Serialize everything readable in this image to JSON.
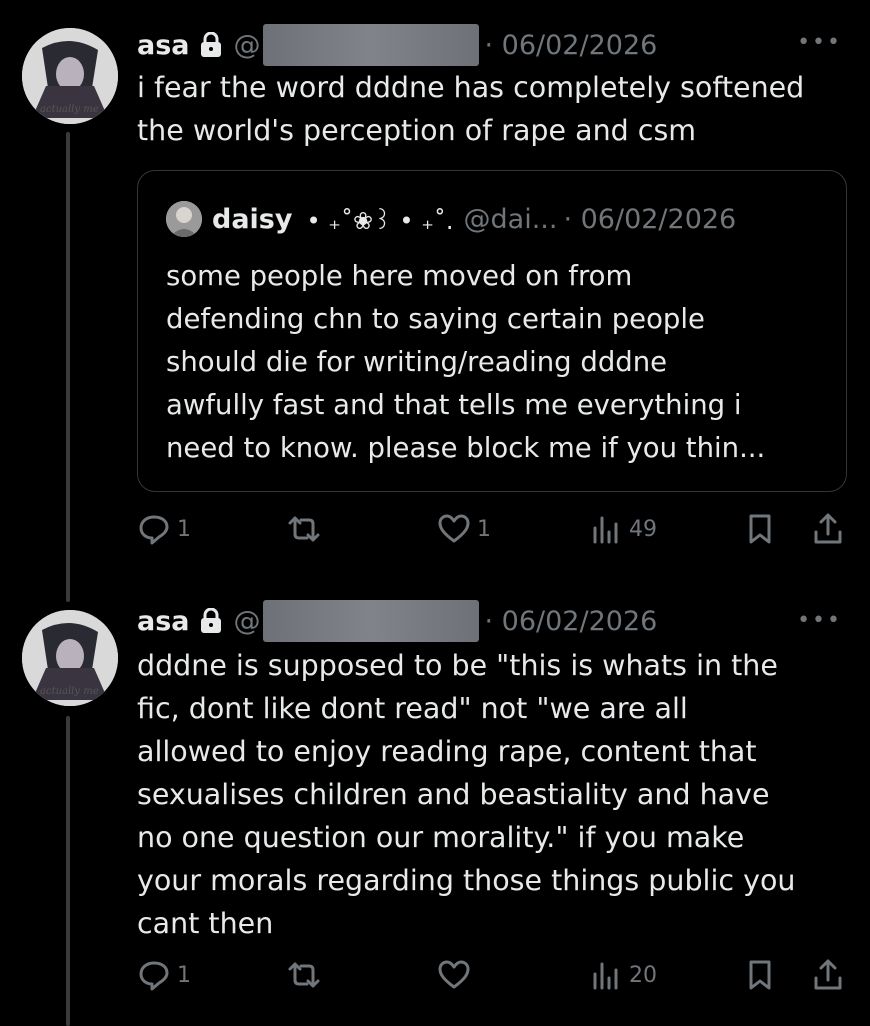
{
  "posts": [
    {
      "author": "asa",
      "handle_prefix": "@",
      "date": "· 06/02/2026",
      "more": "•••",
      "text": "i fear the word dddne has completely softened\nthe world's perception of rape and csm",
      "quote": {
        "author": "daisy",
        "decoration": "• ₊˚❀꒱ • ₊˚.",
        "handle": "@dai...",
        "date": "· 06/02/2026",
        "text": "some people here moved on from\ndefending chn to saying certain people\nshould die for writing/reading dddne\nawfully fast and that tells me everything i\nneed to know. please block me if you thin..."
      },
      "replies": "1",
      "reposts": "",
      "likes": "1",
      "views": "49"
    },
    {
      "author": "asa",
      "handle_prefix": "@",
      "date": "· 06/02/2026",
      "more": "•••",
      "text": "dddne is supposed to be \"this is whats in the\nfic, dont like dont read\" not \"we are all\nallowed to enjoy reading rape, content that\nsexualises children and beastiality and have\nno one question our morality.\" if you make\nyour morals regarding those things public you\ncant then",
      "replies": "1",
      "reposts": "",
      "likes": "",
      "views": "20"
    }
  ],
  "avatar_caption": "actually me",
  "colors": {
    "background": "#000000",
    "text": "#e7e9ea",
    "muted": "#71767b",
    "border": "#333639"
  }
}
